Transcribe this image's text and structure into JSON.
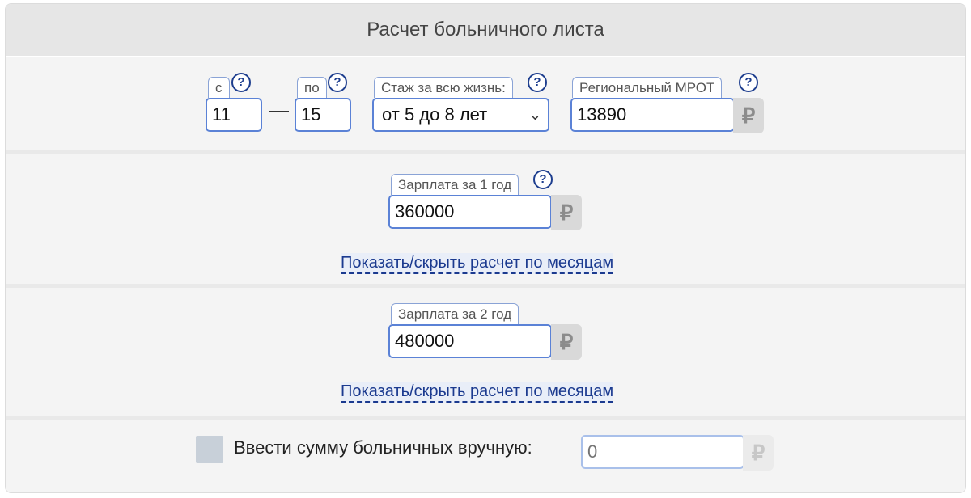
{
  "title": "Расчет больничного листа",
  "period": {
    "from_label": "с",
    "from_value": "11",
    "to_label": "по",
    "to_value": "15",
    "dash": "—"
  },
  "experience": {
    "label": "Стаж за всю жизнь:",
    "selected": "от 5 до 8 лет"
  },
  "mrot": {
    "label": "Региональный МРОТ",
    "value": "13890"
  },
  "year1": {
    "label": "Зарплата за 1 год",
    "value": "360000",
    "toggle_link": "Показать/скрыть расчет по месяцам"
  },
  "year2": {
    "label": "Зарплата за 2 год",
    "value": "480000",
    "toggle_link": "Показать/скрыть расчет по месяцам"
  },
  "manual": {
    "label": "Ввести сумму больничных вручную:",
    "placeholder": "0",
    "checked": false
  },
  "currency_symbol": "₽",
  "help_symbol": "?",
  "colors": {
    "accent_border": "#5b82d6",
    "link": "#1b3a8f",
    "help": "#1f3f8f"
  },
  "icons": {
    "help": "question-circle-icon",
    "currency": "ruble-icon",
    "select": "chevron-down-icon"
  }
}
